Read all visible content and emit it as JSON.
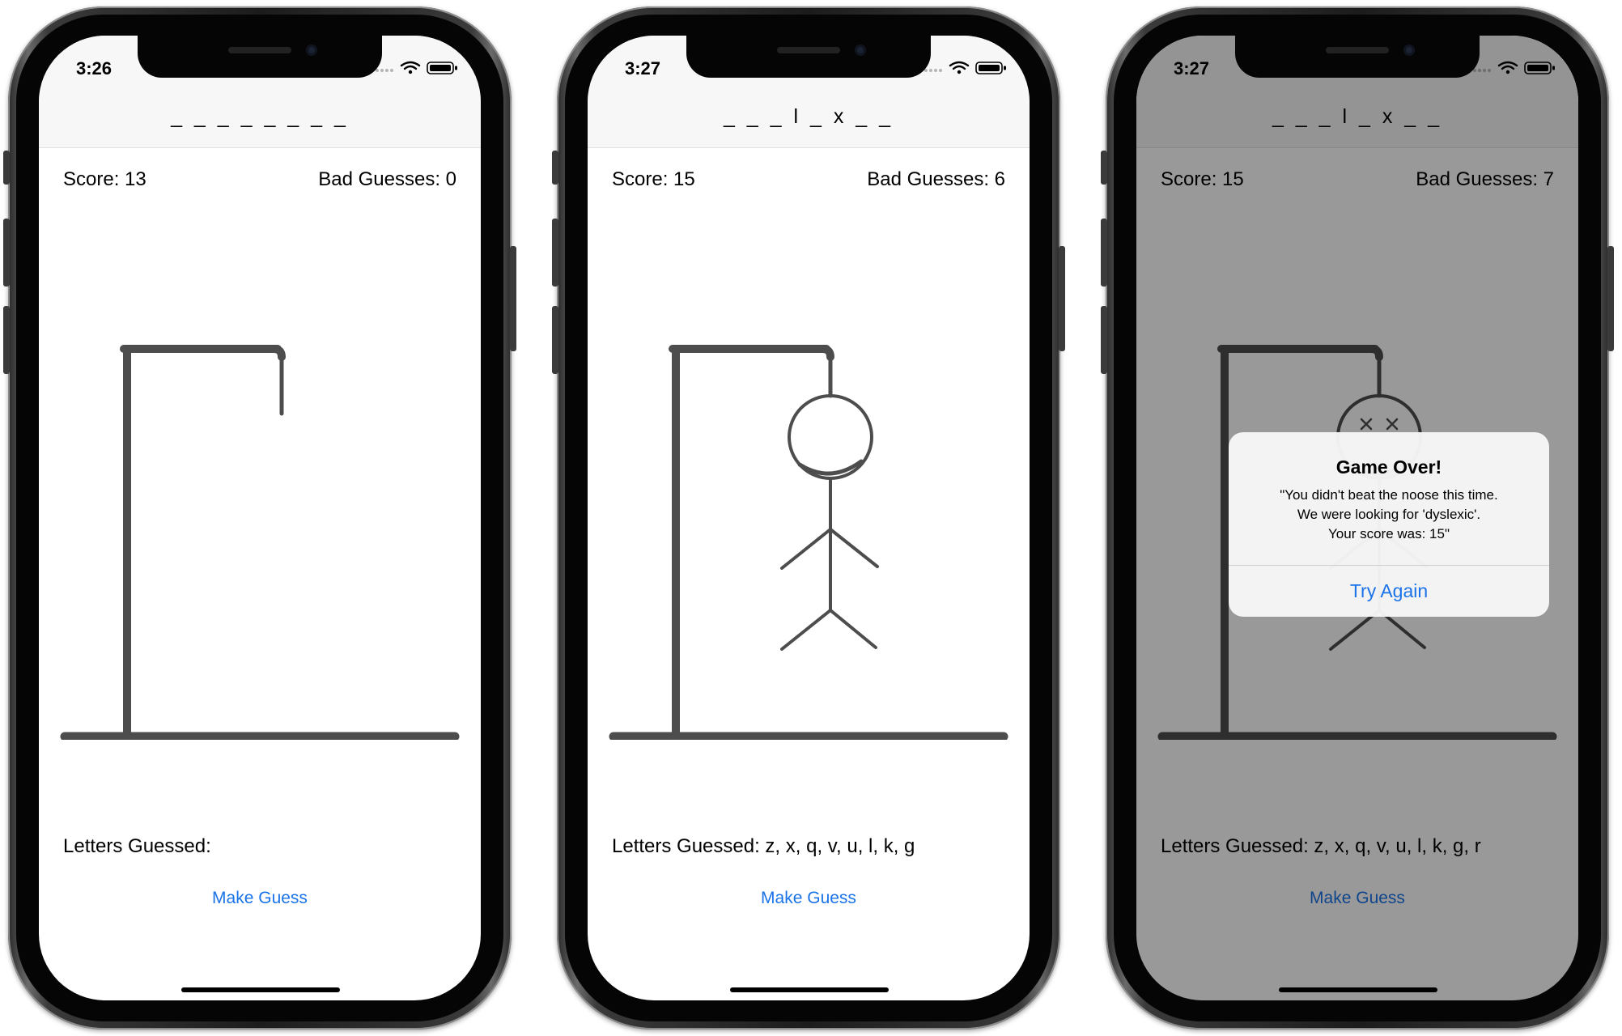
{
  "phones": [
    {
      "time": "3:26",
      "word": "_ _ _ _ _ _ _ _",
      "score": "Score: 13",
      "bad_guesses": "Bad Guesses: 0",
      "letters_guessed": "Letters Guessed:",
      "make_guess_label": "Make Guess"
    },
    {
      "time": "3:27",
      "word": "_ _ _ l _ x _ _",
      "score": "Score: 15",
      "bad_guesses": "Bad Guesses: 6",
      "letters_guessed": "Letters Guessed: z, x, q, v, u, l, k, g",
      "make_guess_label": "Make Guess"
    },
    {
      "time": "3:27",
      "word": "_ _ _ l _ x _ _",
      "score": "Score: 15",
      "bad_guesses": "Bad Guesses: 7",
      "letters_guessed": "Letters Guessed: z, x, q, v, u, l, k, g, r",
      "make_guess_label": "Make Guess",
      "alert": {
        "title": "Game Over!",
        "message_lines": [
          "\"You didn't beat the noose this time.",
          "We were looking for 'dyslexic'.",
          "Your score was: 15\""
        ],
        "button_label": "Try Again"
      }
    }
  ],
  "colors": {
    "accent": "#1a73e8",
    "gallows": "#4d4d4d",
    "nav_background": "#f7f7f7",
    "dim_overlay": "rgba(0,0,0,0.4)"
  },
  "icons": [
    "signal-dots-icon",
    "wifi-icon",
    "battery-icon"
  ]
}
